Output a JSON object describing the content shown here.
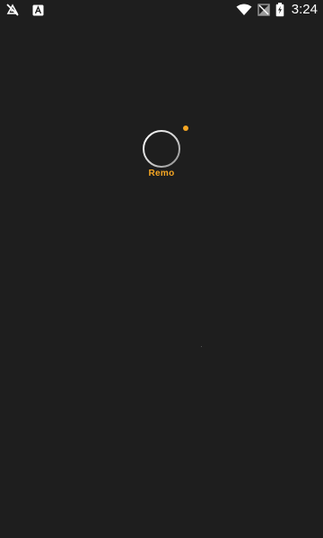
{
  "status_bar": {
    "time": "3:24",
    "icons_left": [
      "notification-off-icon",
      "app-notification-icon"
    ],
    "icons_right": [
      "wifi-icon",
      "no-signal-icon",
      "battery-charging-icon"
    ]
  },
  "splash": {
    "brand_name": "Remo",
    "accent_color": "#f5a623",
    "background_color": "#1e1e1e"
  }
}
